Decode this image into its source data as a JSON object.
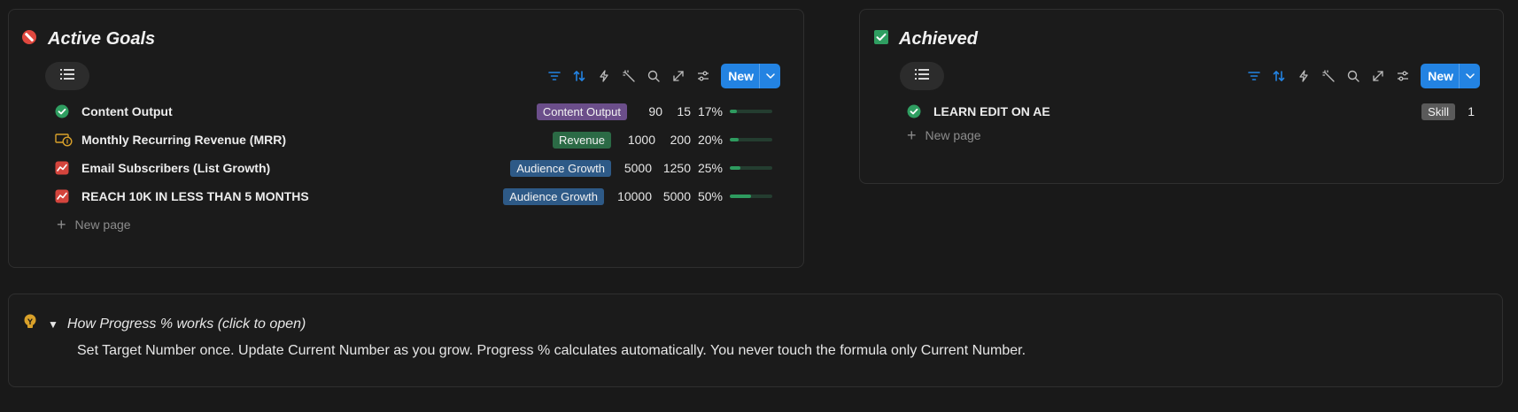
{
  "active": {
    "title": "Active Goals",
    "new_label": "New",
    "new_page_label": "New page",
    "rows": [
      {
        "name": "Content Output",
        "icon": "check-circle-icon",
        "tag": "Content Output",
        "tag_color": "#6b4e8a",
        "target": "90",
        "current": "15",
        "percent": "17%",
        "progress": 0.17
      },
      {
        "name": "Monthly Recurring Revenue (MRR)",
        "icon": "money-icon",
        "tag": "Revenue",
        "tag_color": "#2b6a45",
        "target": "1000",
        "current": "200",
        "percent": "20%",
        "progress": 0.2
      },
      {
        "name": "Email Subscribers (List Growth)",
        "icon": "chart-icon",
        "tag": "Audience Growth",
        "tag_color": "#2e5a87",
        "target": "5000",
        "current": "1250",
        "percent": "25%",
        "progress": 0.25
      },
      {
        "name": "REACH 10K IN LESS THAN 5 MONTHS",
        "icon": "chart-icon",
        "tag": "Audience Growth",
        "tag_color": "#2e5a87",
        "target": "10000",
        "current": "5000",
        "percent": "50%",
        "progress": 0.5
      }
    ]
  },
  "achieved": {
    "title": "Achieved",
    "new_label": "New",
    "new_page_label": "New page",
    "rows": [
      {
        "name": "LEARN EDIT ON AE",
        "icon": "check-circle-icon",
        "tag": "Skill",
        "tag_color": "#5a5a5a",
        "value": "1"
      }
    ]
  },
  "callout": {
    "title": "How Progress % works (click to open)",
    "body": "Set Target Number once. Update Current Number as you grow. Progress % calculates automatically. You never touch the formula only Current Number.",
    "toggle_glyph": "▼"
  },
  "colors": {
    "accent": "#2383e2",
    "progress": "#2e9b5f",
    "stop_red": "#e0483f",
    "check_green": "#2f9e61",
    "bulb_yellow": "#d9a12a"
  }
}
